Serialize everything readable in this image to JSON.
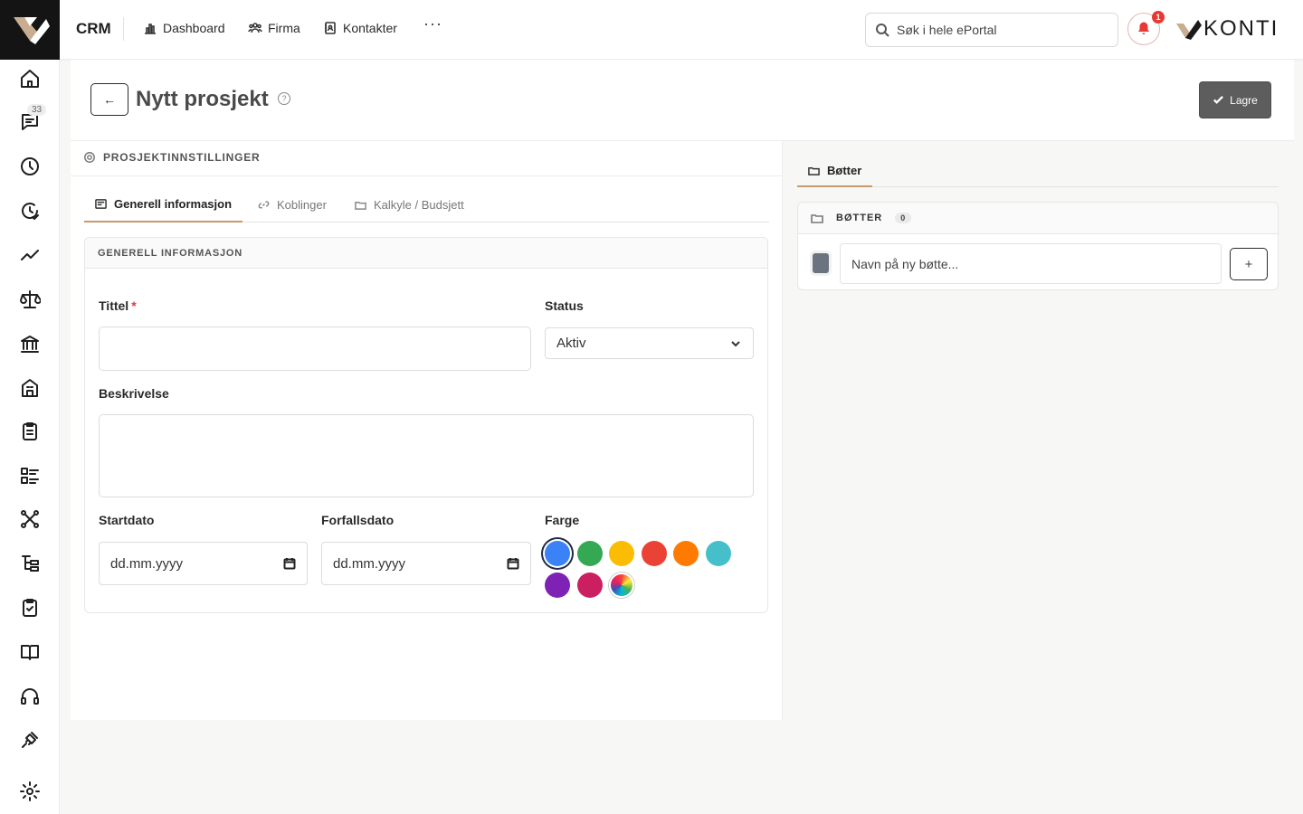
{
  "topbar": {
    "app_name": "CRM",
    "nav": [
      {
        "label": "Dashboard",
        "icon": "bar-chart-icon"
      },
      {
        "label": "Firma",
        "icon": "users-icon"
      },
      {
        "label": "Kontakter",
        "icon": "contact-book-icon"
      }
    ],
    "more_label": "···",
    "search_placeholder": "Søk i hele ePortal",
    "notification_count": "1",
    "brand_name": "KONTI"
  },
  "rail": {
    "messages_badge": "33",
    "items": [
      "home-icon",
      "chat-icon",
      "clock-icon",
      "history-check-icon",
      "trend-icon",
      "scale-icon",
      "bank-icon",
      "building-icon",
      "clipboard-list-icon",
      "list-icon",
      "network-icon",
      "tree-icon",
      "clipboard-check-icon",
      "book-icon",
      "headset-icon",
      "plug-icon",
      "settings-icon"
    ]
  },
  "page": {
    "title": "Nytt prosjekt",
    "help": "?",
    "back": "←",
    "save_label": "Lagre"
  },
  "settings": {
    "section_title": "PROSJEKTINNSTILLINGER",
    "tabs": [
      {
        "label": "Generell informasjon",
        "active": true
      },
      {
        "label": "Koblinger",
        "active": false
      },
      {
        "label": "Kalkyle / Budsjett",
        "active": false
      }
    ],
    "card_title": "GENERELL INFORMASJON",
    "form": {
      "title_label": "Tittel",
      "required_mark": "*",
      "title_value": "",
      "status_label": "Status",
      "status_value": "Aktiv",
      "description_label": "Beskrivelse",
      "description_value": "",
      "start_label": "Startdato",
      "start_value": "dd.mm.yyyy",
      "due_label": "Forfallsdato",
      "due_value": "dd.mm.yyyy",
      "color_label": "Farge",
      "colors": [
        "#3b82f6",
        "#34a853",
        "#fbbc04",
        "#ea4335",
        "#ff7a00",
        "#45bfc9",
        "#7e22b5",
        "#cc1f62"
      ],
      "selected_color": "#3b82f6"
    }
  },
  "buckets": {
    "tab_label": "Bøtter",
    "card_title": "BØTTER",
    "count": "0",
    "input_placeholder": "Navn på ny bøtte...",
    "default_color": "#6b7280",
    "add_label": "+"
  }
}
